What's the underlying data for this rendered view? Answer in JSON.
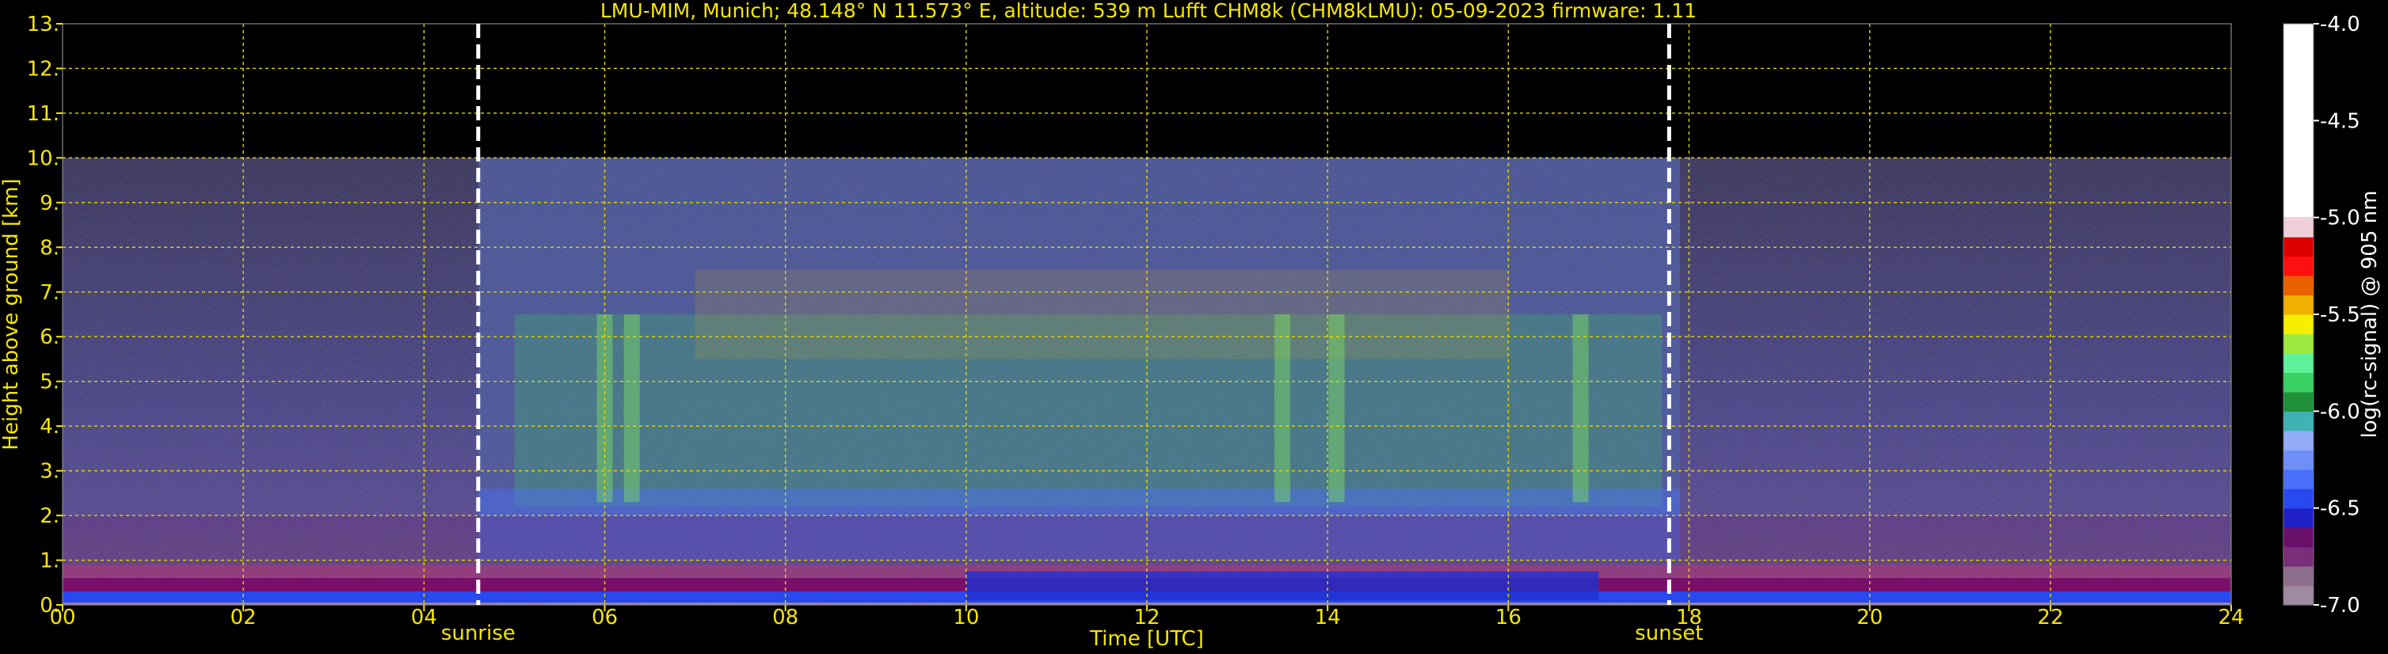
{
  "chart_data": {
    "type": "heatmap",
    "title": "LMU-MIM, Munich; 48.148° N 11.573° E, altitude: 539 m    Lufft CHM8k (CHM8kLMU): 05-09-2023    firmware: 1.11",
    "xlabel": "Time [UTC]",
    "ylabel": "Height above ground [km]",
    "xlim": [
      0,
      24
    ],
    "ylim": [
      0,
      13
    ],
    "x_ticks": [
      "00",
      "02",
      "04",
      "06",
      "08",
      "10",
      "12",
      "14",
      "16",
      "18",
      "20",
      "22",
      "24"
    ],
    "y_ticks": [
      "0.",
      "1.",
      "2.",
      "3.",
      "4.",
      "5.",
      "6.",
      "7.",
      "8.",
      "9.",
      "10.",
      "11.",
      "12.",
      "13."
    ],
    "grid": true,
    "data_top_km": 10,
    "colorbar": {
      "label": "log(rc-signal) @ 905 nm",
      "range": [
        -7.0,
        -4.0
      ],
      "ticks": [
        "-4.0",
        "-4.5",
        "-5.0",
        "-5.5",
        "-6.0",
        "-6.5",
        "-7.0"
      ],
      "colors": [
        "#a08aa0",
        "#8c6e8c",
        "#782e78",
        "#6a0f6a",
        "#2020c8",
        "#2848f0",
        "#4a6ff8",
        "#6f8ff8",
        "#93acf8",
        "#3fb3b3",
        "#1f8f3a",
        "#38d060",
        "#5ff09a",
        "#9fe840",
        "#f6f000",
        "#f0b000",
        "#e86000",
        "#ff1010",
        "#dc0000",
        "#f0d0d8",
        "#ffffff"
      ]
    },
    "markers": [
      {
        "label": "sunrise",
        "time_h": 4.6
      },
      {
        "label": "sunset",
        "time_h": 17.78
      }
    ],
    "features": {
      "aerosol_layer_top_km": 0.9,
      "daytime_window_h": [
        4.6,
        17.9
      ],
      "cloud_plumes_h": [
        6.0,
        6.3,
        13.5,
        14.1,
        16.8
      ]
    }
  }
}
